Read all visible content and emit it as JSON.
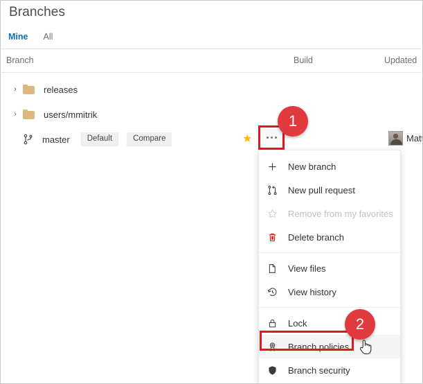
{
  "page": {
    "title": "Branches"
  },
  "tabs": [
    {
      "label": "Mine",
      "selected": true
    },
    {
      "label": "All",
      "selected": false
    }
  ],
  "grid": {
    "columns": {
      "branch": "Branch",
      "build": "Build",
      "updated": "Updated"
    },
    "rows": [
      {
        "type": "folder",
        "chevron": "›",
        "icon": "folder-icon",
        "name": "releases"
      },
      {
        "type": "folder",
        "chevron": "›",
        "icon": "folder-icon",
        "name": "users/mmitrik"
      },
      {
        "type": "branch",
        "icon": "git-branch-icon",
        "name": "master",
        "tags": [
          "Default",
          "Compare"
        ],
        "favorite_icon": "star-filled-icon",
        "more_actions_label": "…",
        "author": "Matt"
      }
    ]
  },
  "context_menu": {
    "items": [
      {
        "label": "New branch",
        "icon": "plus-icon",
        "disabled": false,
        "hovered": false,
        "separator_before": false
      },
      {
        "label": "New pull request",
        "icon": "pull-request-icon",
        "disabled": false,
        "hovered": false,
        "separator_before": false
      },
      {
        "label": "Remove from my favorites",
        "icon": "star-outline-icon",
        "disabled": true,
        "hovered": false,
        "separator_before": false
      },
      {
        "label": "Delete branch",
        "icon": "trash-icon",
        "disabled": false,
        "hovered": false,
        "separator_before": false
      },
      {
        "label": "View files",
        "icon": "file-icon",
        "disabled": false,
        "hovered": false,
        "separator_before": true
      },
      {
        "label": "View history",
        "icon": "history-icon",
        "disabled": false,
        "hovered": false,
        "separator_before": false
      },
      {
        "label": "Lock",
        "icon": "lock-icon",
        "disabled": false,
        "hovered": false,
        "separator_before": true
      },
      {
        "label": "Branch policies",
        "icon": "policy-ribbon-icon",
        "disabled": false,
        "hovered": true,
        "separator_before": false
      },
      {
        "label": "Branch security",
        "icon": "shield-icon",
        "disabled": false,
        "hovered": false,
        "separator_before": false
      }
    ]
  },
  "callouts": [
    {
      "number": "1",
      "target": "more-actions-button"
    },
    {
      "number": "2",
      "target": "menu-item-branch-policies"
    }
  ],
  "colors": {
    "accent": "#106ebe",
    "callout_red": "#e0393e",
    "highlight_red": "#e3171e",
    "folder": "#dbb87d",
    "star": "#ffb900",
    "delete_red": "#e3171e"
  }
}
